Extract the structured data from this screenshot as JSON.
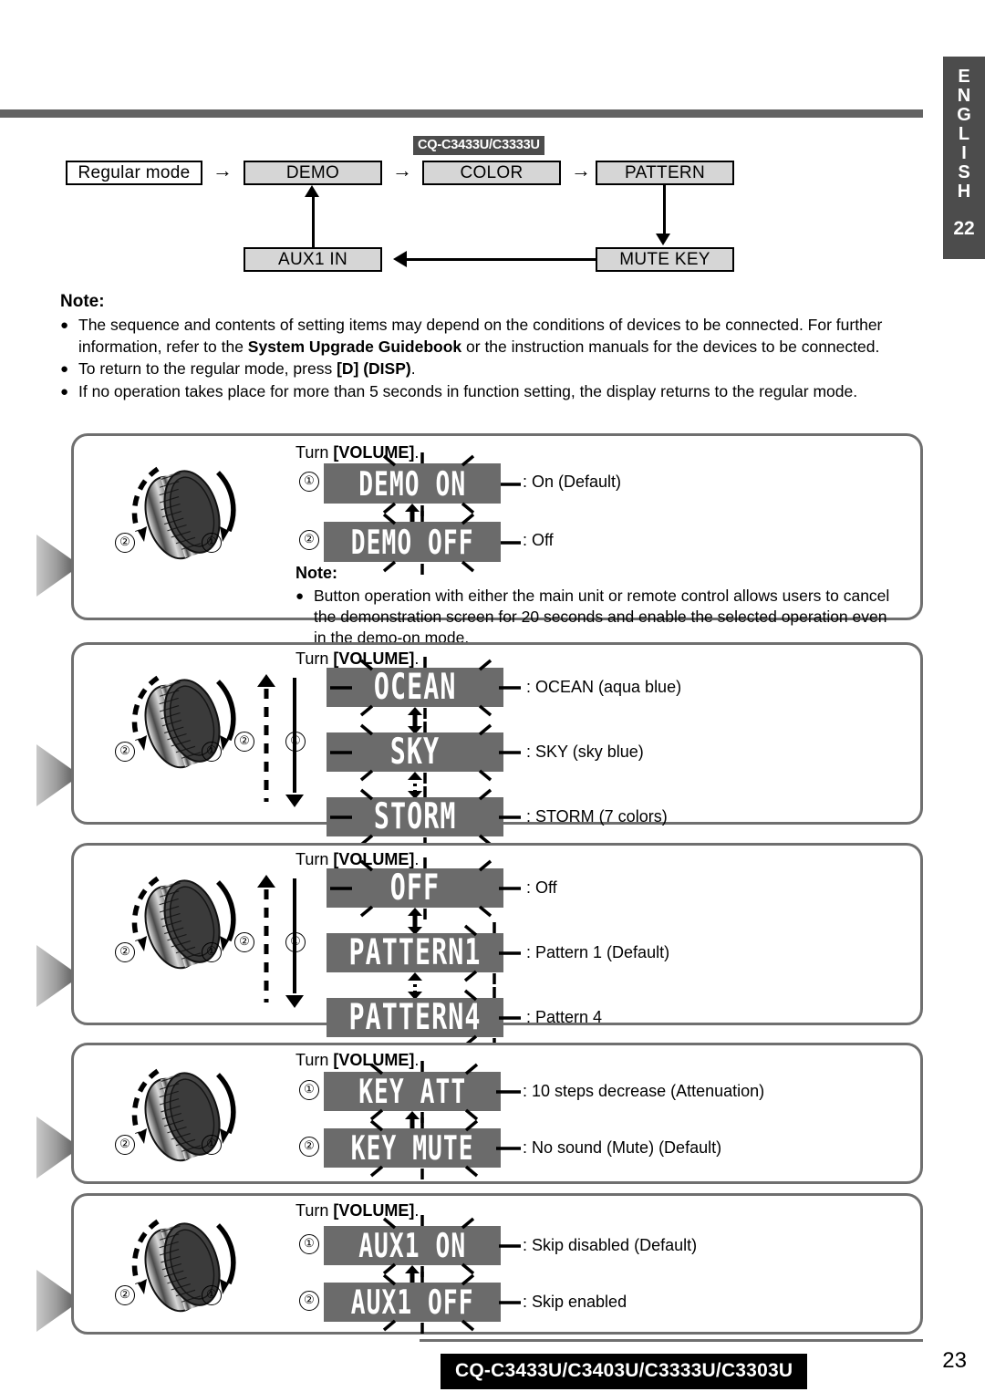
{
  "language_tab": {
    "letters": [
      "E",
      "N",
      "G",
      "L",
      "I",
      "S",
      "H"
    ],
    "page": "22"
  },
  "flow": {
    "badge": "CQ-C3433U/C3333U",
    "boxes": {
      "regular": "Regular mode",
      "demo": "DEMO",
      "color": "COLOR",
      "pattern": "PATTERN",
      "mute": "MUTE KEY",
      "aux": "AUX1 IN"
    },
    "arrow_glyph": "→"
  },
  "note": {
    "title": "Note:",
    "items": [
      {
        "pre": "The sequence and contents of setting items may depend on the conditions of devices to be connected. For further information, refer to the ",
        "bold": "System Upgrade Guidebook",
        "post": " or the instruction manuals for the devices to be connected."
      },
      {
        "pre": "To return to the regular mode, press ",
        "bold": "[D] (DISP)",
        "post": "."
      },
      {
        "pre": "If no operation takes place for more than 5 seconds in function setting, the display returns to the regular mode.",
        "bold": "",
        "post": ""
      }
    ],
    "bullet_glyph": "●"
  },
  "panels": [
    {
      "id": "demo",
      "turn_prefix": "Turn ",
      "turn_key": "[VOLUME]",
      "turn_suffix": ".",
      "rows": [
        {
          "num": "①",
          "lcd": "DEMO ON",
          "desc": ": On (Default)"
        },
        {
          "num": "②",
          "lcd": "DEMO OFF",
          "desc": ": Off"
        }
      ],
      "note_title": "Note:",
      "note_text": "Button operation with either the main unit or remote control allows users to cancel the demonstration screen for 20 seconds and enable the selected operation even in the demo-on mode.",
      "knob_labels": [
        "①",
        "②"
      ]
    },
    {
      "id": "color",
      "turn_prefix": "Turn ",
      "turn_key": "[VOLUME]",
      "turn_suffix": ".",
      "loop_labels": [
        "①",
        "②"
      ],
      "rows": [
        {
          "num": "",
          "lcd": "OCEAN",
          "desc": ": OCEAN (aqua blue)"
        },
        {
          "num": "",
          "lcd": "SKY",
          "desc": ": SKY (sky blue)"
        },
        {
          "num": "",
          "lcd": "STORM",
          "desc": ": STORM (7 colors)"
        }
      ],
      "knob_labels": [
        "①",
        "②"
      ]
    },
    {
      "id": "pattern",
      "turn_prefix": "Turn ",
      "turn_key": "[VOLUME]",
      "turn_suffix": ".",
      "loop_labels": [
        "①",
        "②"
      ],
      "rows": [
        {
          "num": "",
          "lcd": "OFF",
          "desc": ": Off"
        },
        {
          "num": "",
          "lcd": "PATTERN1",
          "desc": ": Pattern 1 (Default)"
        },
        {
          "num": "",
          "lcd": "PATTERN4",
          "desc": ": Pattern 4"
        }
      ],
      "knob_labels": [
        "①",
        "②"
      ]
    },
    {
      "id": "mutekey",
      "turn_prefix": "Turn ",
      "turn_key": "[VOLUME]",
      "turn_suffix": ".",
      "rows": [
        {
          "num": "①",
          "lcd": "KEY ATT",
          "desc": ": 10 steps  decrease (Attenuation)"
        },
        {
          "num": "②",
          "lcd": "KEY MUTE",
          "desc": ": No sound (Mute) (Default)"
        }
      ],
      "knob_labels": [
        "①",
        "②"
      ]
    },
    {
      "id": "aux1in",
      "turn_prefix": "Turn ",
      "turn_key": "[VOLUME]",
      "turn_suffix": ".",
      "rows": [
        {
          "num": "①",
          "lcd": "AUX1 ON",
          "desc": ": Skip disabled (Default)"
        },
        {
          "num": "②",
          "lcd": "AUX1 OFF",
          "desc": ": Skip enabled"
        }
      ],
      "knob_labels": [
        "①",
        "②"
      ]
    }
  ],
  "footer": {
    "model": "CQ-C3433U/C3403U/C3333U/C3303U",
    "page": "23"
  },
  "colors": {
    "rule": "#636363",
    "tab": "#4c4c4c",
    "lcd_bg": "#6b6b6b",
    "box_grey": "#d6d6d6",
    "panel_border": "#6f6f6f"
  }
}
